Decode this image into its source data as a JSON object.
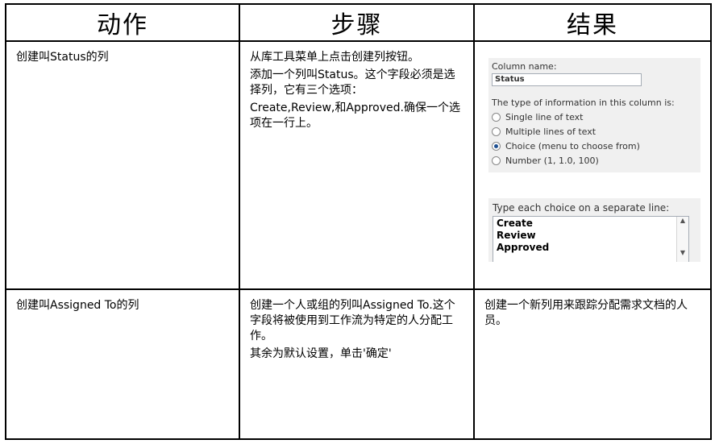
{
  "headers": {
    "action": "动作",
    "steps": "步骤",
    "result": "结果"
  },
  "row1": {
    "action": "创建叫Status的列",
    "steps": [
      "从库工具菜单上点击创建列按钮。",
      "添加一个列叫Status。这个字段必须是选择列，它有三个选项：",
      "Create,Review,和Approved.确保一个选项在一行上。"
    ],
    "shot": {
      "column_name_label": "Column name:",
      "column_name_value": "Status",
      "type_label": "The type of information in this column is:",
      "options": [
        {
          "label": "Single line of text",
          "selected": false
        },
        {
          "label": "Multiple lines of text",
          "selected": false
        },
        {
          "label": "Choice (menu to choose from)",
          "selected": true
        },
        {
          "label": "Number (1, 1.0, 100)",
          "selected": false
        }
      ],
      "choices_label": "Type each choice on a separate line:",
      "choices": [
        "Create",
        "Review",
        "Approved"
      ],
      "scroll_up": "▲",
      "scroll_down": "▼"
    }
  },
  "row2": {
    "action": "创建叫Assigned To的列",
    "steps": [
      "创建一个人或组的列叫Assigned To.这个字段将被使用到工作流为特定的人分配工作。",
      "其余为默认设置，单击'确定'"
    ],
    "result": "创建一个新列用来跟踪分配需求文档的人员。"
  }
}
